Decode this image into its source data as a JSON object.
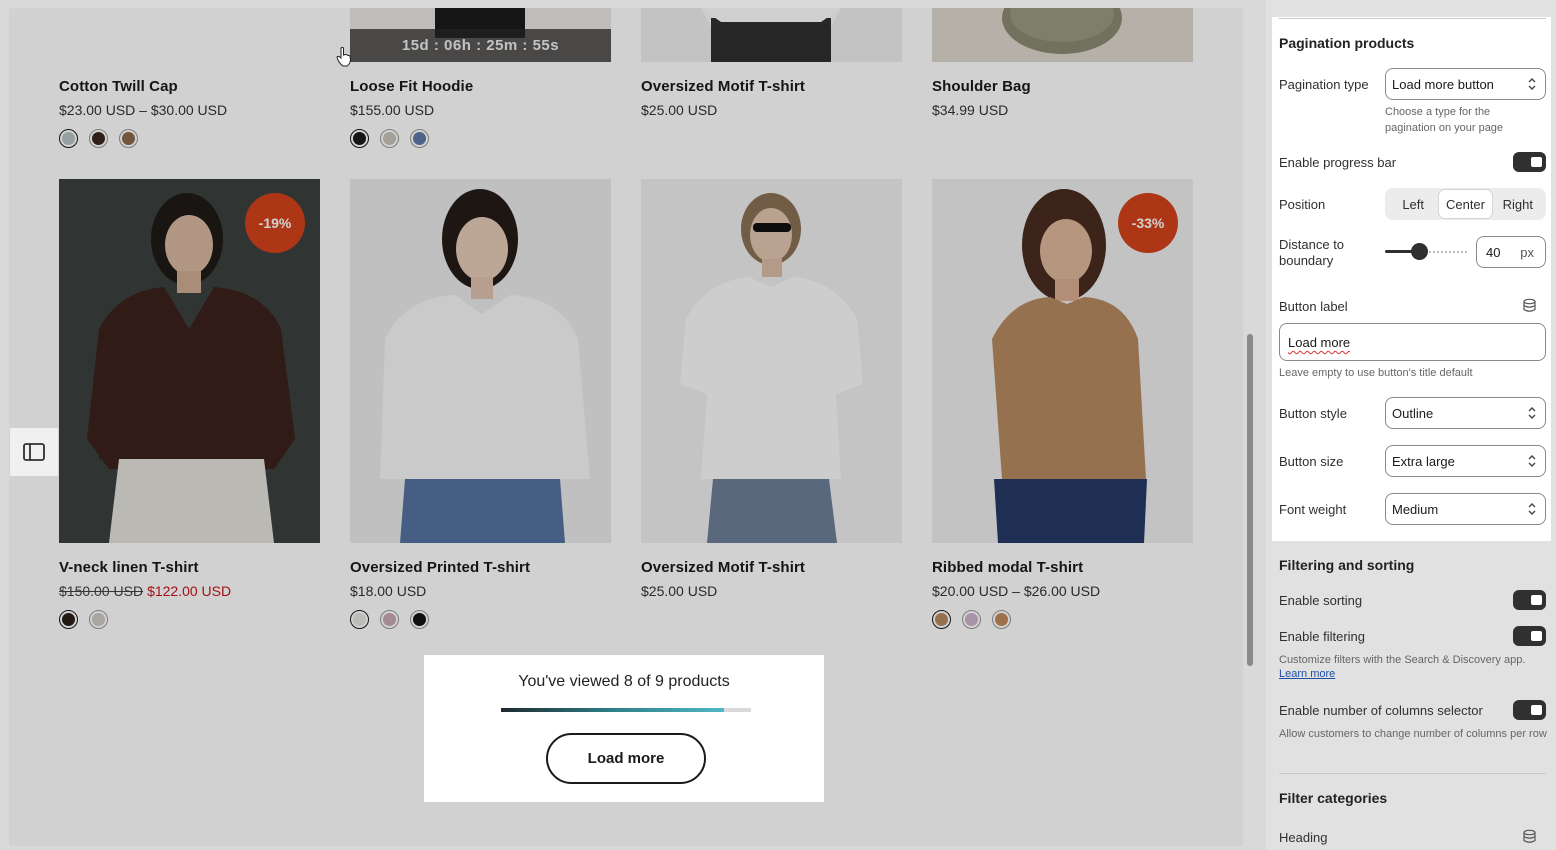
{
  "products_top": [
    {
      "title": "Cotton Twill Cap",
      "price": "$23.00 USD – $30.00 USD",
      "swatches": [
        "#b8c4c6",
        "#3b2520",
        "#8b6a4a"
      ],
      "active": 0
    },
    {
      "title": "Loose Fit Hoodie",
      "price": "$155.00 USD",
      "swatches": [
        "#1c1c1c",
        "#c9c3bb",
        "#5e79a8"
      ],
      "active": 0,
      "countdown": "15d : 06h : 25m : 55s"
    },
    {
      "title": "Oversized Motif T-shirt",
      "price": "$25.00 USD",
      "swatches": []
    },
    {
      "title": "Shoulder Bag",
      "price": "$34.99 USD",
      "swatches": []
    }
  ],
  "products_bottom": [
    {
      "title": "V-neck linen T-shirt",
      "old_price": "$150.00 USD",
      "sale_price": "$122.00 USD",
      "badge": "-19%",
      "swatches": [
        "#2e1f1a",
        "#cfcac2"
      ],
      "active": 0
    },
    {
      "title": "Oversized Printed T-shirt",
      "price": "$18.00 USD",
      "swatches": [
        "#e8e6e2",
        "#caa8b4",
        "#141414"
      ],
      "active": 0
    },
    {
      "title": "Oversized Motif T-shirt",
      "price": "$25.00 USD",
      "swatches": []
    },
    {
      "title": "Ribbed modal T-shirt",
      "price": "$20.00 USD – $26.00 USD",
      "badge": "-33%",
      "swatches": [
        "#b68a62",
        "#cfb4cd",
        "#c08a5c"
      ],
      "active": 0
    }
  ],
  "load_more": {
    "viewed_text": "You've viewed 8 of 9 products",
    "progress": 0.89,
    "button_label": "Load more"
  },
  "panel": {
    "section_pagination": "Pagination products",
    "pagination_type_label": "Pagination type",
    "pagination_type_value": "Load more button",
    "pagination_type_help": "Choose a type for the pagination on your page",
    "progress_bar_label": "Enable progress bar",
    "progress_bar_on": true,
    "position_label": "Position",
    "position_options": [
      "Left",
      "Center",
      "Right"
    ],
    "position_selected": "Center",
    "distance_label": "Distance to boundary",
    "distance_value": "40",
    "distance_unit": "px",
    "button_label_label": "Button label",
    "button_label_value": "Load more",
    "button_label_help": "Leave empty to use button's title default",
    "button_style_label": "Button style",
    "button_style_value": "Outline",
    "button_size_label": "Button size",
    "button_size_value": "Extra large",
    "font_weight_label": "Font weight",
    "font_weight_value": "Medium",
    "section_filtering": "Filtering and sorting",
    "enable_sorting_label": "Enable sorting",
    "enable_filtering_label": "Enable filtering",
    "filtering_help": "Customize filters with the Search & Discovery app.",
    "learn_more": "Learn more",
    "columns_selector_label": "Enable number of columns selector",
    "columns_selector_help": "Allow customers to change number of columns per row",
    "section_filter_categories": "Filter categories",
    "heading_label": "Heading"
  },
  "colors": {
    "accent_badge": "#d4421c",
    "sale_price": "#c7141a",
    "toggle_on": "#303030"
  }
}
